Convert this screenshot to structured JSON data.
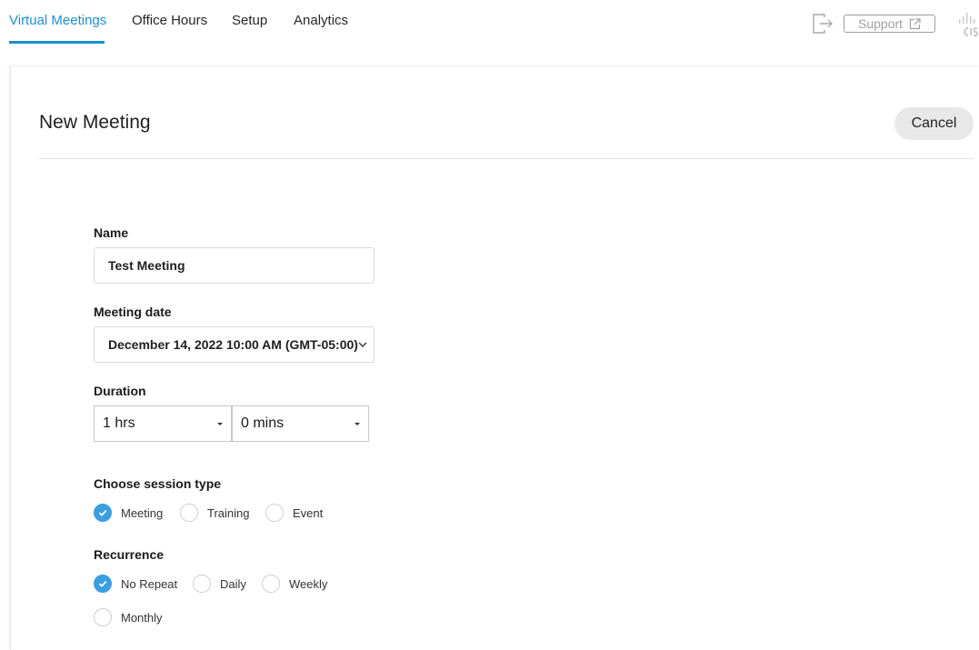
{
  "nav": {
    "tabs": [
      {
        "label": "Virtual Meetings",
        "active": true
      },
      {
        "label": "Office Hours",
        "active": false
      },
      {
        "label": "Setup",
        "active": false
      },
      {
        "label": "Analytics",
        "active": false
      }
    ],
    "support_label": "Support",
    "icons": {
      "signout": "sign-out-icon",
      "external": "external-link-icon",
      "logo": "cisco-logo"
    }
  },
  "page": {
    "title": "New Meeting",
    "cancel_label": "Cancel"
  },
  "form": {
    "name_label": "Name",
    "name_value": "Test Meeting",
    "date_label": "Meeting date",
    "date_value": "December 14, 2022 10:00 AM (GMT-05:00)",
    "duration_label": "Duration",
    "duration_hours": "1 hrs",
    "duration_minutes": "0 mins",
    "session_label": "Choose session type",
    "session_options": [
      {
        "label": "Meeting",
        "checked": true
      },
      {
        "label": "Training",
        "checked": false
      },
      {
        "label": "Event",
        "checked": false
      }
    ],
    "recurrence_label": "Recurrence",
    "recurrence_options": [
      {
        "label": "No Repeat",
        "checked": true
      },
      {
        "label": "Daily",
        "checked": false
      },
      {
        "label": "Weekly",
        "checked": false
      },
      {
        "label": "Monthly",
        "checked": false
      }
    ]
  },
  "colors": {
    "accent": "#1c8fce",
    "radio_checked": "#3a9fe0",
    "cancel_bg": "#e8e8e8"
  }
}
